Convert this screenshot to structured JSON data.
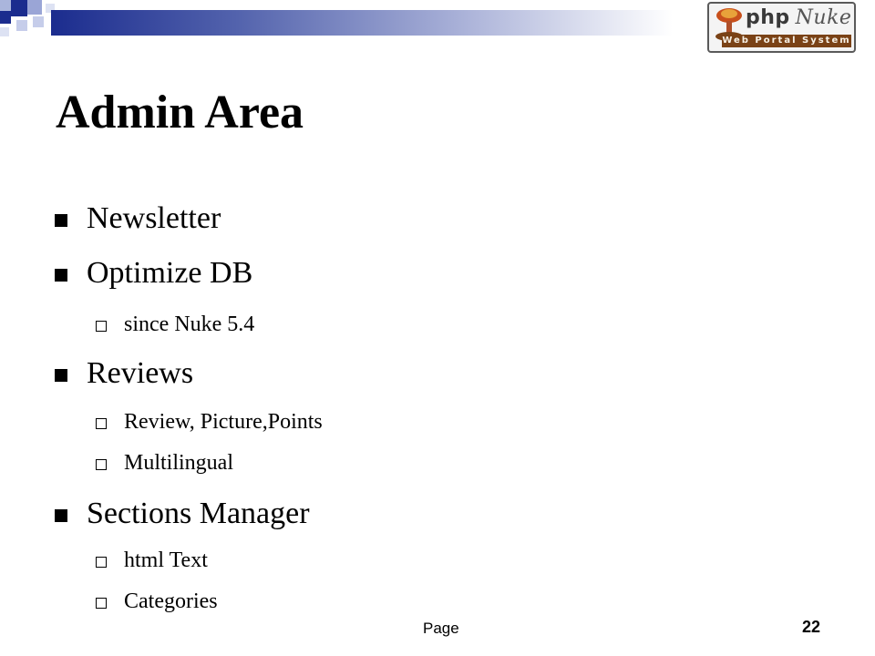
{
  "slide": {
    "title": "Admin Area",
    "logo": {
      "top_text": "php",
      "top_text_2": "Nuke",
      "bottom_text": "Web Portal System"
    },
    "bullets": [
      {
        "text": "Newsletter",
        "sub": []
      },
      {
        "text": "Optimize DB",
        "sub": [
          "since Nuke 5.4"
        ]
      },
      {
        "text": "Reviews",
        "sub": [
          "Review, Picture,Points",
          "Multilingual"
        ]
      },
      {
        "text": "Sections Manager",
        "sub": [
          "html Text",
          "Categories"
        ]
      }
    ],
    "footer": {
      "page_label": "Page",
      "page_number": "22"
    },
    "colors": {
      "accent": "#1b2c8e",
      "logo_band": "#7a4216"
    }
  }
}
